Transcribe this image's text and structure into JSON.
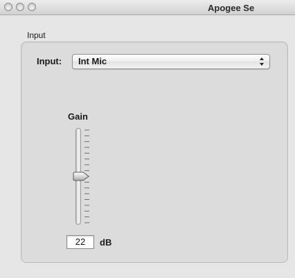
{
  "window": {
    "title": "Apogee Se",
    "controls": [
      "close",
      "minimize",
      "zoom"
    ]
  },
  "input_group": {
    "label": "Input",
    "selector_label": "Input:",
    "selected": "Int Mic"
  },
  "gain": {
    "label": "Gain",
    "value": "22",
    "unit": "dB",
    "tick_count": 17
  }
}
